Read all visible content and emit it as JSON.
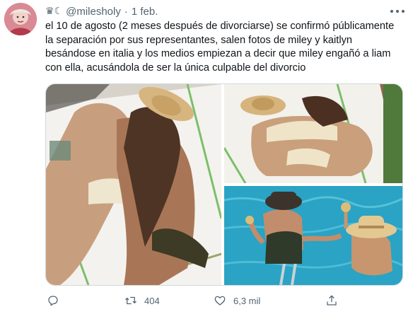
{
  "author": {
    "badge": "♛☾",
    "handle": "@milesholy",
    "separator": "·",
    "date": "1 feb."
  },
  "tweet": {
    "lines": [
      "el 10 de agosto (2 meses después de divorciarse) se confirmó públicamente",
      "la separación por sus representantes, salen fotos de miley y kaitlyn",
      "besándose en italia y los medios empiezan a decir que miley engañó a liam",
      "con ella, acusándola de ser la única culpable del divorcio"
    ]
  },
  "actions": {
    "reply_icon": "reply-icon",
    "retweet_icon": "retweet-icon",
    "retweet_count": "404",
    "like_icon": "heart-icon",
    "like_count": "6,3 mil",
    "share_icon": "share-icon"
  },
  "colors": {
    "text": "#0f1419",
    "secondary": "#536471",
    "border": "#cfd9de",
    "pool": "#2aa3c4",
    "hat": "#c9a468"
  }
}
